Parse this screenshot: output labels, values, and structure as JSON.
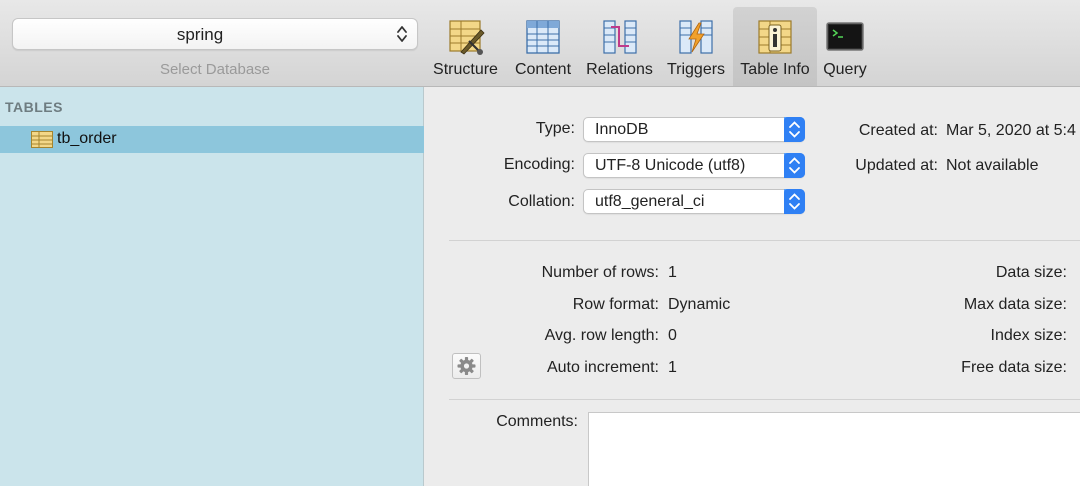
{
  "toolbar": {
    "database": {
      "selected": "spring",
      "caption": "Select Database"
    },
    "tools": [
      {
        "label": "Structure"
      },
      {
        "label": "Content"
      },
      {
        "label": "Relations"
      },
      {
        "label": "Triggers"
      },
      {
        "label": "Table Info",
        "active": true
      },
      {
        "label": "Query"
      }
    ]
  },
  "sidebar": {
    "header": "TABLES",
    "items": [
      {
        "name": "tb_order",
        "selected": true
      }
    ]
  },
  "info": {
    "type_label": "Type:",
    "type_value": "InnoDB",
    "encoding_label": "Encoding:",
    "encoding_value": "UTF-8 Unicode (utf8)",
    "collation_label": "Collation:",
    "collation_value": "utf8_general_ci",
    "created_label": "Created at:",
    "created_value": "Mar 5, 2020 at 5:4",
    "updated_label": "Updated at:",
    "updated_value": "Not available",
    "rows_label": "Number of rows:",
    "rows_value": "1",
    "row_format_label": "Row format:",
    "row_format_value": "Dynamic",
    "avg_row_label": "Avg. row length:",
    "avg_row_value": "0",
    "auto_inc_label": "Auto increment:",
    "auto_inc_value": "1",
    "data_size_label": "Data size:",
    "max_data_size_label": "Max data size:",
    "index_size_label": "Index size:",
    "free_data_size_label": "Free data size:",
    "comments_label": "Comments:"
  },
  "colors": {
    "sidebar_bg": "#cbe4eb",
    "sidebar_selected": "#8dc6dc",
    "stepper_blue": "#2c7ef4"
  }
}
